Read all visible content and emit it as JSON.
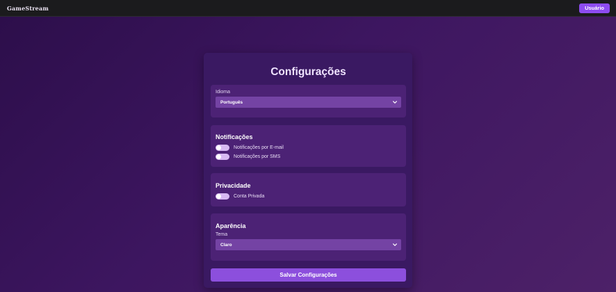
{
  "header": {
    "logo": "GameStream",
    "user_button": "Usuário"
  },
  "settings": {
    "title": "Configurações",
    "language": {
      "label": "Idioma",
      "selected": "Português"
    },
    "notifications": {
      "heading": "Notificações",
      "email_label": "Notificações por E-mail",
      "sms_label": "Notificações por SMS"
    },
    "privacy": {
      "heading": "Privacidade",
      "private_account_label": "Conta Privada"
    },
    "appearance": {
      "heading": "Aparência",
      "theme_label": "Tema",
      "theme_selected": "Claro"
    },
    "save_button": "Salvar Configurações"
  },
  "icons": {
    "select_arrow": "chevron-down-icon"
  },
  "colors": {
    "accent": "#8d4cf0",
    "background_start": "#2c0e4a",
    "background_end": "#4d2168",
    "card": "#3a1962",
    "section": "#4c2275",
    "select": "#7443a4",
    "toggle": "#d7b8f2",
    "topbar": "#1b1b1d"
  }
}
